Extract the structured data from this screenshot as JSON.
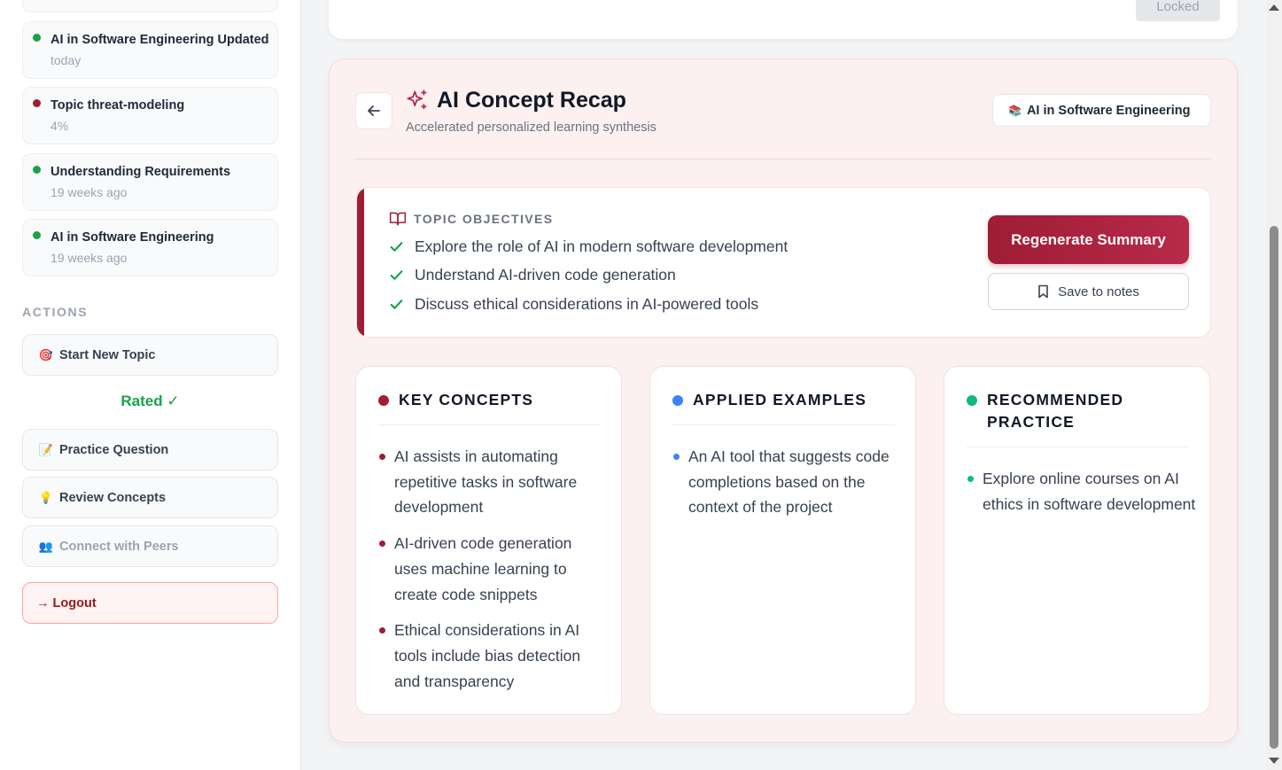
{
  "sidebar": {
    "recent": [
      {
        "title": "AI in Software Engineering Updated",
        "sub": "today",
        "status_color": "#16a34a"
      },
      {
        "title": "Topic threat-modeling",
        "sub": "4%",
        "status_color": "#9f1d35"
      },
      {
        "title": "Understanding Requirements",
        "sub": "19 weeks ago",
        "status_color": "#16a34a"
      },
      {
        "title": "AI in Software Engineering",
        "sub": "19 weeks ago",
        "status_color": "#16a34a"
      }
    ],
    "actions_label": "ACTIONS",
    "actions": {
      "start_new_topic": {
        "icon": "target-icon",
        "label": "Start New Topic"
      },
      "rated": "Rated ✓",
      "practice_question": {
        "icon": "memo-icon",
        "label": "Practice Question"
      },
      "review_concepts": {
        "icon": "lightbulb-icon",
        "label": "Review Concepts"
      },
      "connect_peers": {
        "icon": "people-icon",
        "label": "Connect with Peers"
      }
    },
    "logout": "→ Logout"
  },
  "top_card": {
    "locked_label": "Locked"
  },
  "recap": {
    "title": "AI Concept Recap",
    "subtitle": "Accelerated personalized learning synthesis",
    "topic_chip": "AI in Software Engineering",
    "objectives": {
      "heading": "TOPIC OBJECTIVES",
      "items": [
        "Explore the role of AI in modern software development",
        "Understand AI-driven code generation",
        "Discuss ethical considerations in AI-powered tools"
      ],
      "regenerate_label": "Regenerate Summary",
      "save_label": "Save to notes"
    },
    "cards": [
      {
        "heading": "KEY CONCEPTS",
        "color": "#9f1d35",
        "items": [
          "AI assists in automating repetitive tasks in software development",
          "AI-driven code generation uses machine learning to create code snippets",
          "Ethical considerations in AI tools include bias detection and transparency"
        ]
      },
      {
        "heading": "APPLIED EXAMPLES",
        "color": "#3b82f6",
        "items": [
          "An AI tool that suggests code completions based on the context of the project"
        ]
      },
      {
        "heading": "RECOMMENDED PRACTICE",
        "color": "#10b981",
        "items": [
          "Explore online courses on AI ethics in software development"
        ]
      }
    ]
  }
}
